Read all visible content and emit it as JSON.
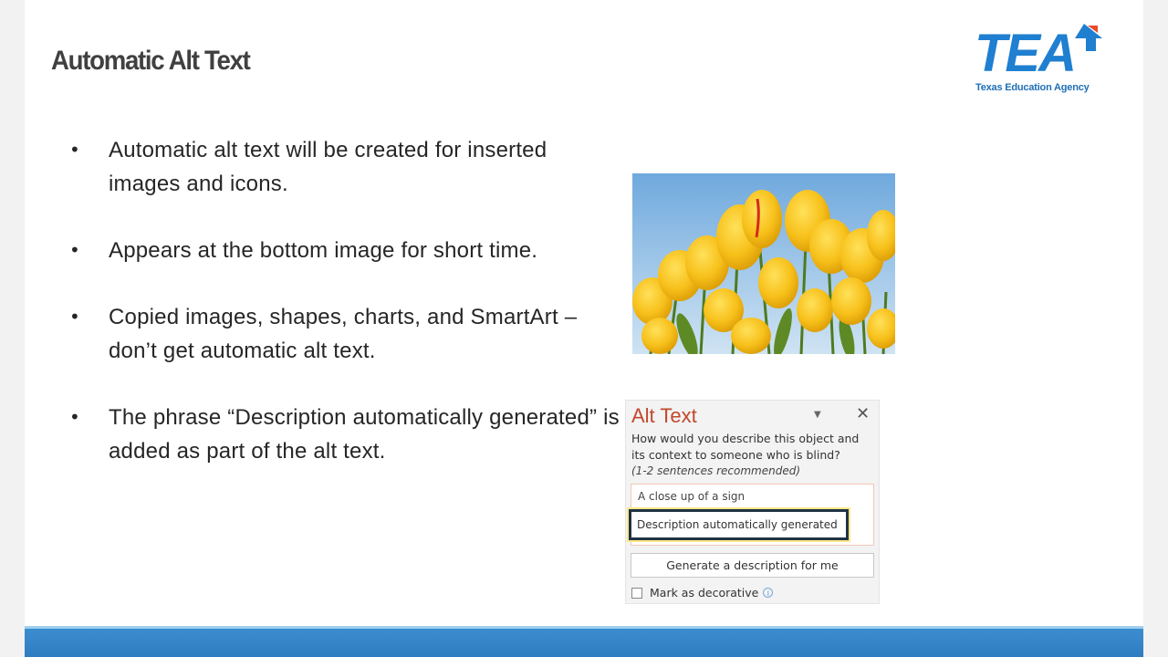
{
  "slide": {
    "title": "Automatic Alt Text",
    "logo": {
      "wordmark": "TEA",
      "subtitle": "Texas Education Agency",
      "color": "#1f7fd0"
    },
    "bullets": [
      "Automatic alt text will be created for inserted images and icons.",
      "Appears at the bottom image for short time.",
      "Copied images, shapes, charts, and SmartArt – don’t get automatic alt text.",
      "The phrase “Description automatically generated” is added as part of the alt text."
    ],
    "bullet_glyph": "•",
    "photo": {
      "subject": "yellow tulips against blue sky"
    },
    "bottom_bar_color": "#2f7cc0"
  },
  "alt_text_panel": {
    "title": "Alt Text",
    "title_color": "#c3482b",
    "dropdown_icon": "▼",
    "close_icon": "✕",
    "prompt": "How would you describe this object and its context to someone who is blind?",
    "hint": "(1-2 sentences recommended)",
    "description_line1": "A close up of a sign",
    "description_line2": "Description automatically generated",
    "generate_button": "Generate a description for me",
    "decorative_label": "Mark as decorative",
    "decorative_checked": false,
    "info_icon": "i"
  }
}
